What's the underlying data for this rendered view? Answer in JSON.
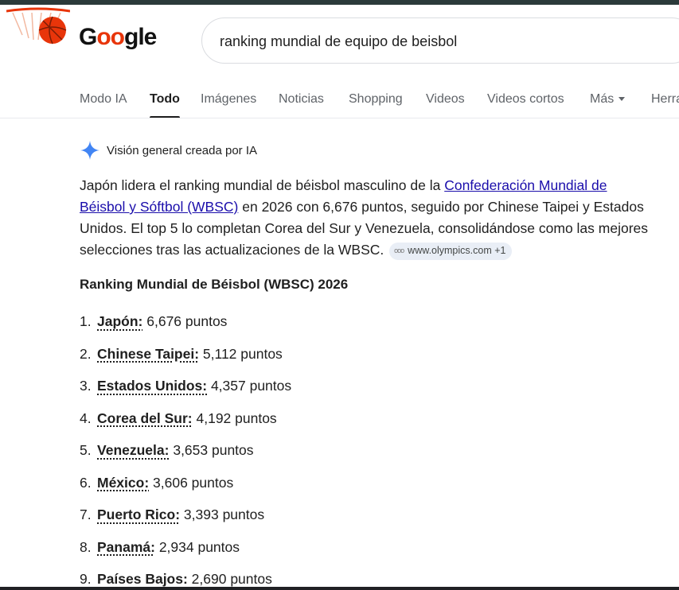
{
  "header": {
    "logo_text_start": "G",
    "logo_text_doodle": "oo",
    "logo_text_end": "gle",
    "search_query": "ranking mundial de equipo de beisbol"
  },
  "tabs": [
    {
      "label": "Modo IA",
      "active": false
    },
    {
      "label": "Todo",
      "active": true
    },
    {
      "label": "Imágenes",
      "active": false
    },
    {
      "label": "Noticias",
      "active": false
    },
    {
      "label": "Shopping",
      "active": false
    },
    {
      "label": "Videos",
      "active": false
    },
    {
      "label": "Videos cortos",
      "active": false
    },
    {
      "label": "Más",
      "active": false
    },
    {
      "label": "Herra",
      "active": false
    }
  ],
  "ai_overview": {
    "heading": "Visión general creada por IA",
    "summary_part1": "Japón lidera el ranking mundial de béisbol masculino de la ",
    "summary_link": "Confederación Mundial de Béisbol y Sóftbol (WBSC)",
    "summary_part2": " en 2026 con 6,676 puntos, seguido por Chinese Taipei y Estados Unidos. El top 5 lo completan Corea del Sur y Venezuela, consolidándose como las mejores selecciones tras las actualizaciones de la WBSC.",
    "source_chip": "www.olympics.com +1",
    "section_title": "Ranking Mundial de Béisbol (WBSC) 2026"
  },
  "ranking": [
    {
      "num": "1.",
      "country": "Japón:",
      "points": " 6,676 puntos"
    },
    {
      "num": "2.",
      "country": "Chinese Taipei:",
      "points": " 5,112 puntos"
    },
    {
      "num": "3.",
      "country": "Estados Unidos:",
      "points": " 4,357 puntos"
    },
    {
      "num": "4.",
      "country": "Corea del Sur:",
      "points": " 4,192 puntos"
    },
    {
      "num": "5.",
      "country": "Venezuela:",
      "points": " 3,653 puntos"
    },
    {
      "num": "6.",
      "country": "México:",
      "points": " 3,606 puntos"
    },
    {
      "num": "7.",
      "country": "Puerto Rico:",
      "points": " 3,393 puntos"
    },
    {
      "num": "8.",
      "country": "Panamá:",
      "points": " 2,934 puntos"
    },
    {
      "num": "9.",
      "country": "Países Bajos:",
      "points": " 2,690 puntos"
    }
  ],
  "colors": {
    "link": "#1a0dab",
    "ai_sparkle": "#4285f4",
    "doodle_ball": "#e8350a"
  }
}
